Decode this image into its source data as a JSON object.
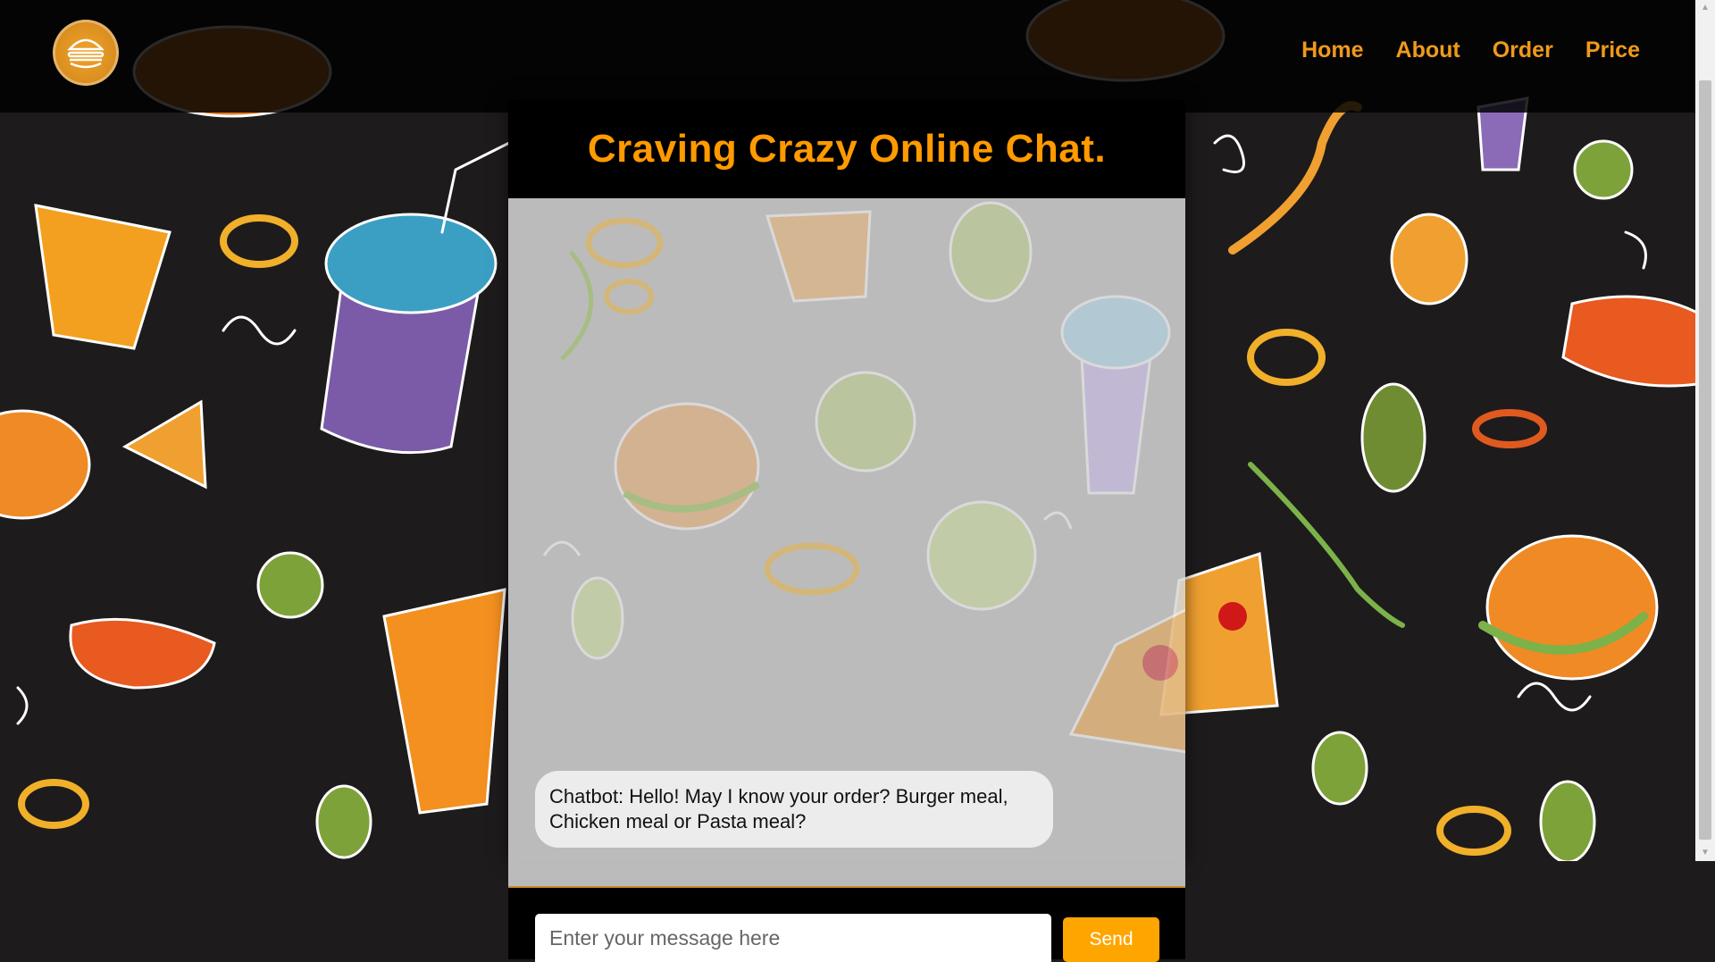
{
  "nav": {
    "logo_icon": "burger-logo-icon",
    "items": [
      {
        "label": "Home"
      },
      {
        "label": "About"
      },
      {
        "label": "Order"
      },
      {
        "label": "Price"
      }
    ]
  },
  "chat": {
    "title": "Craving Crazy Online Chat.",
    "messages": [
      {
        "text": "Chatbot: Hello! May I know your order? Burger meal, Chicken meal or Pasta meal?"
      }
    ],
    "input_placeholder": "Enter your message here",
    "send_label": "Send"
  },
  "colors": {
    "accent": "#ff9a00",
    "nav_text": "#f09a1a",
    "background": "#1e1b1c",
    "send_button": "#ffa500"
  }
}
